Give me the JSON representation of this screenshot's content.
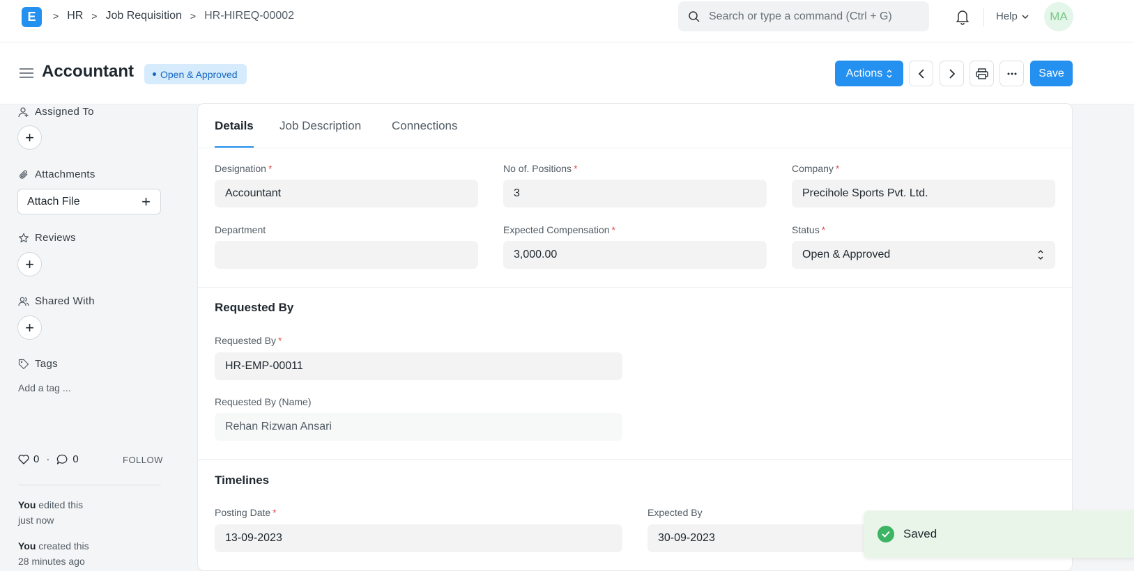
{
  "navbar": {
    "logo": "E",
    "breadcrumbs": [
      "HR",
      "Job Requisition",
      "HR-HIREQ-00002"
    ],
    "search_placeholder": "Search or type a command (Ctrl + G)",
    "help_label": "Help",
    "avatar_initials": "MA"
  },
  "header": {
    "title": "Accountant",
    "status_badge": "Open & Approved",
    "actions_label": "Actions",
    "save_label": "Save"
  },
  "sidebar": {
    "assigned_to": "Assigned To",
    "attachments": "Attachments",
    "attach_file": "Attach File",
    "reviews": "Reviews",
    "shared_with": "Shared With",
    "tags": "Tags",
    "add_tag": "Add a tag ...",
    "likes": "0",
    "comments": "0",
    "dot": "·",
    "follow": "FOLLOW",
    "activity": [
      {
        "who": "You",
        "what": " edited this",
        "when": "just now"
      },
      {
        "who": "You",
        "what": " created this",
        "when": "28 minutes ago"
      }
    ]
  },
  "tabs": [
    "Details",
    "Job Description",
    "Connections"
  ],
  "form": {
    "designation": {
      "label": "Designation",
      "value": "Accountant"
    },
    "positions": {
      "label": "No of. Positions",
      "value": "3"
    },
    "company": {
      "label": "Company",
      "value": "Precihole Sports Pvt. Ltd."
    },
    "department": {
      "label": "Department",
      "value": ""
    },
    "compensation": {
      "label": "Expected Compensation",
      "value": "3,000.00"
    },
    "status": {
      "label": "Status",
      "value": "Open & Approved"
    },
    "requested_section": "Requested By",
    "requested_by": {
      "label": "Requested By",
      "value": "HR-EMP-00011"
    },
    "requested_by_name": {
      "label": "Requested By (Name)",
      "value": "Rehan Rizwan Ansari"
    },
    "timelines_section": "Timelines",
    "posting_date": {
      "label": "Posting Date",
      "value": "13-09-2023"
    },
    "expected_by": {
      "label": "Expected By",
      "value": "30-09-2023"
    },
    "required_marker": "*"
  },
  "toast": {
    "message": "Saved"
  },
  "colors": {
    "primary": "#2490ef",
    "badge_bg": "#d6ebfb",
    "success": "#3cb463"
  }
}
